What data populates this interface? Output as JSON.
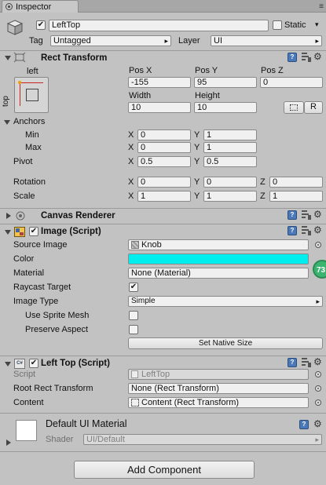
{
  "window": {
    "tab_label": "Inspector",
    "menu_glyph": "≡"
  },
  "gameobject": {
    "name": "LeftTop",
    "static_label": "Static",
    "tag_label": "Tag",
    "tag_value": "Untagged",
    "layer_label": "Layer",
    "layer_value": "UI",
    "active_check": "✔",
    "static_check": ""
  },
  "rect_transform": {
    "title": "Rect Transform",
    "anchor_top_label": "left",
    "anchor_side_label": "top",
    "pos_x_label": "Pos X",
    "pos_x": "-155",
    "pos_y_label": "Pos Y",
    "pos_y": "95",
    "pos_z_label": "Pos Z",
    "pos_z": "0",
    "width_label": "Width",
    "width": "10",
    "height_label": "Height",
    "height": "10",
    "r_button": "R",
    "anchors_label": "Anchors",
    "min_label": "Min",
    "min_x": "0",
    "min_y": "1",
    "max_label": "Max",
    "max_x": "0",
    "max_y": "1",
    "pivot_label": "Pivot",
    "pivot_x": "0.5",
    "pivot_y": "0.5",
    "rotation_label": "Rotation",
    "rot_x": "0",
    "rot_y": "0",
    "rot_z": "0",
    "scale_label": "Scale",
    "scale_x": "1",
    "scale_y": "1",
    "scale_z": "1",
    "axis_x": "X",
    "axis_y": "Y",
    "axis_z": "Z"
  },
  "canvas_renderer": {
    "title": "Canvas Renderer"
  },
  "image": {
    "title": "Image (Script)",
    "enabled_check": "✔",
    "source_label": "Source Image",
    "source_value": "Knob",
    "color_label": "Color",
    "color_value": "#00eeee",
    "material_label": "Material",
    "material_value": "None (Material)",
    "raycast_label": "Raycast Target",
    "raycast_check": "✔",
    "type_label": "Image Type",
    "type_value": "Simple",
    "sprite_mesh_label": "Use Sprite Mesh",
    "sprite_mesh_check": "",
    "preserve_label": "Preserve Aspect",
    "preserve_check": "",
    "native_button": "Set Native Size",
    "badge": "73"
  },
  "left_top": {
    "title": "Left Top (Script)",
    "cs_badge": "C#",
    "enabled_check": "✔",
    "script_label": "Script",
    "script_value": "LeftTop",
    "root_label": "Root Rect Transform",
    "root_value": "None (Rect Transform)",
    "content_label": "Content",
    "content_value": "Content (Rect Transform)"
  },
  "material": {
    "title": "Default UI Material",
    "shader_label": "Shader",
    "shader_value": "UI/Default"
  },
  "add_component": "Add Component",
  "icons": {
    "help": "?",
    "gear": "⚙",
    "help_color": "#4a78b8",
    "badge_color": "#3cb371"
  }
}
